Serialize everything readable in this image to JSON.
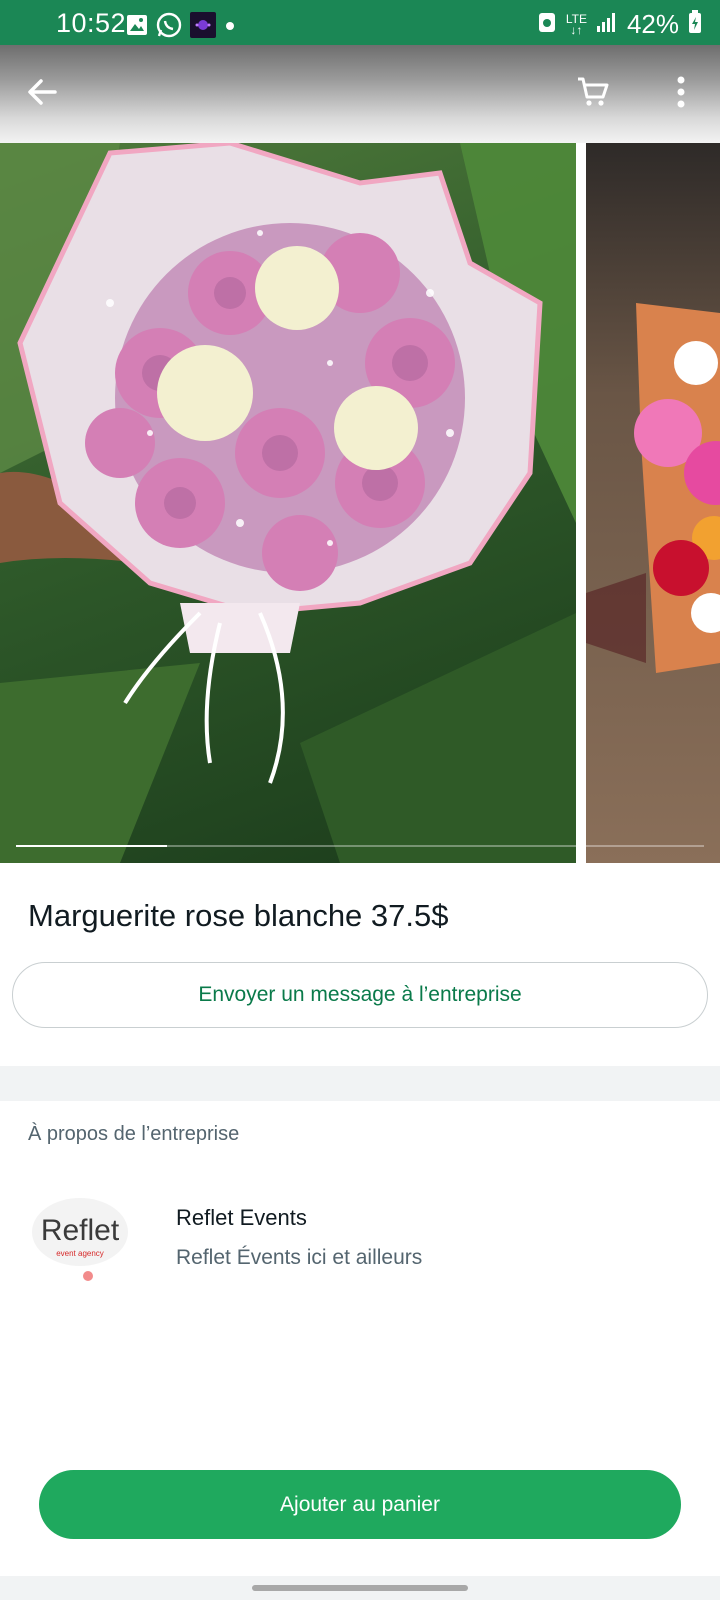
{
  "status_bar": {
    "time": "10:52",
    "network": "LTE",
    "battery": "42%",
    "left_icons": [
      "gallery-icon",
      "whatsapp-icon",
      "app-icon",
      "dot-icon"
    ],
    "right_icons": [
      "alarm-icon",
      "lte-icon",
      "signal-icon",
      "battery-icon"
    ]
  },
  "app_bar": {
    "icons": [
      "back-arrow-icon",
      "cart-icon",
      "more-vert-icon"
    ]
  },
  "carousel": {
    "slide_count": 2,
    "current_index": 0,
    "progress_fraction": 0.22
  },
  "product": {
    "title": "Marguerite rose blanche 37.5$"
  },
  "actions": {
    "message_label": "Envoyer un message à l’entreprise",
    "add_to_cart_label": "Ajouter au panier"
  },
  "about": {
    "label": "À propos de l’entreprise",
    "business_name": "Reflet Events",
    "business_description": "Reflet Évents ici et ailleurs",
    "logo_text": "Reflet",
    "logo_subtext": "event agency"
  },
  "colors": {
    "status_bar": "#1b8755",
    "accent_green": "#1fa95e",
    "link_green": "#0a7a4a"
  }
}
